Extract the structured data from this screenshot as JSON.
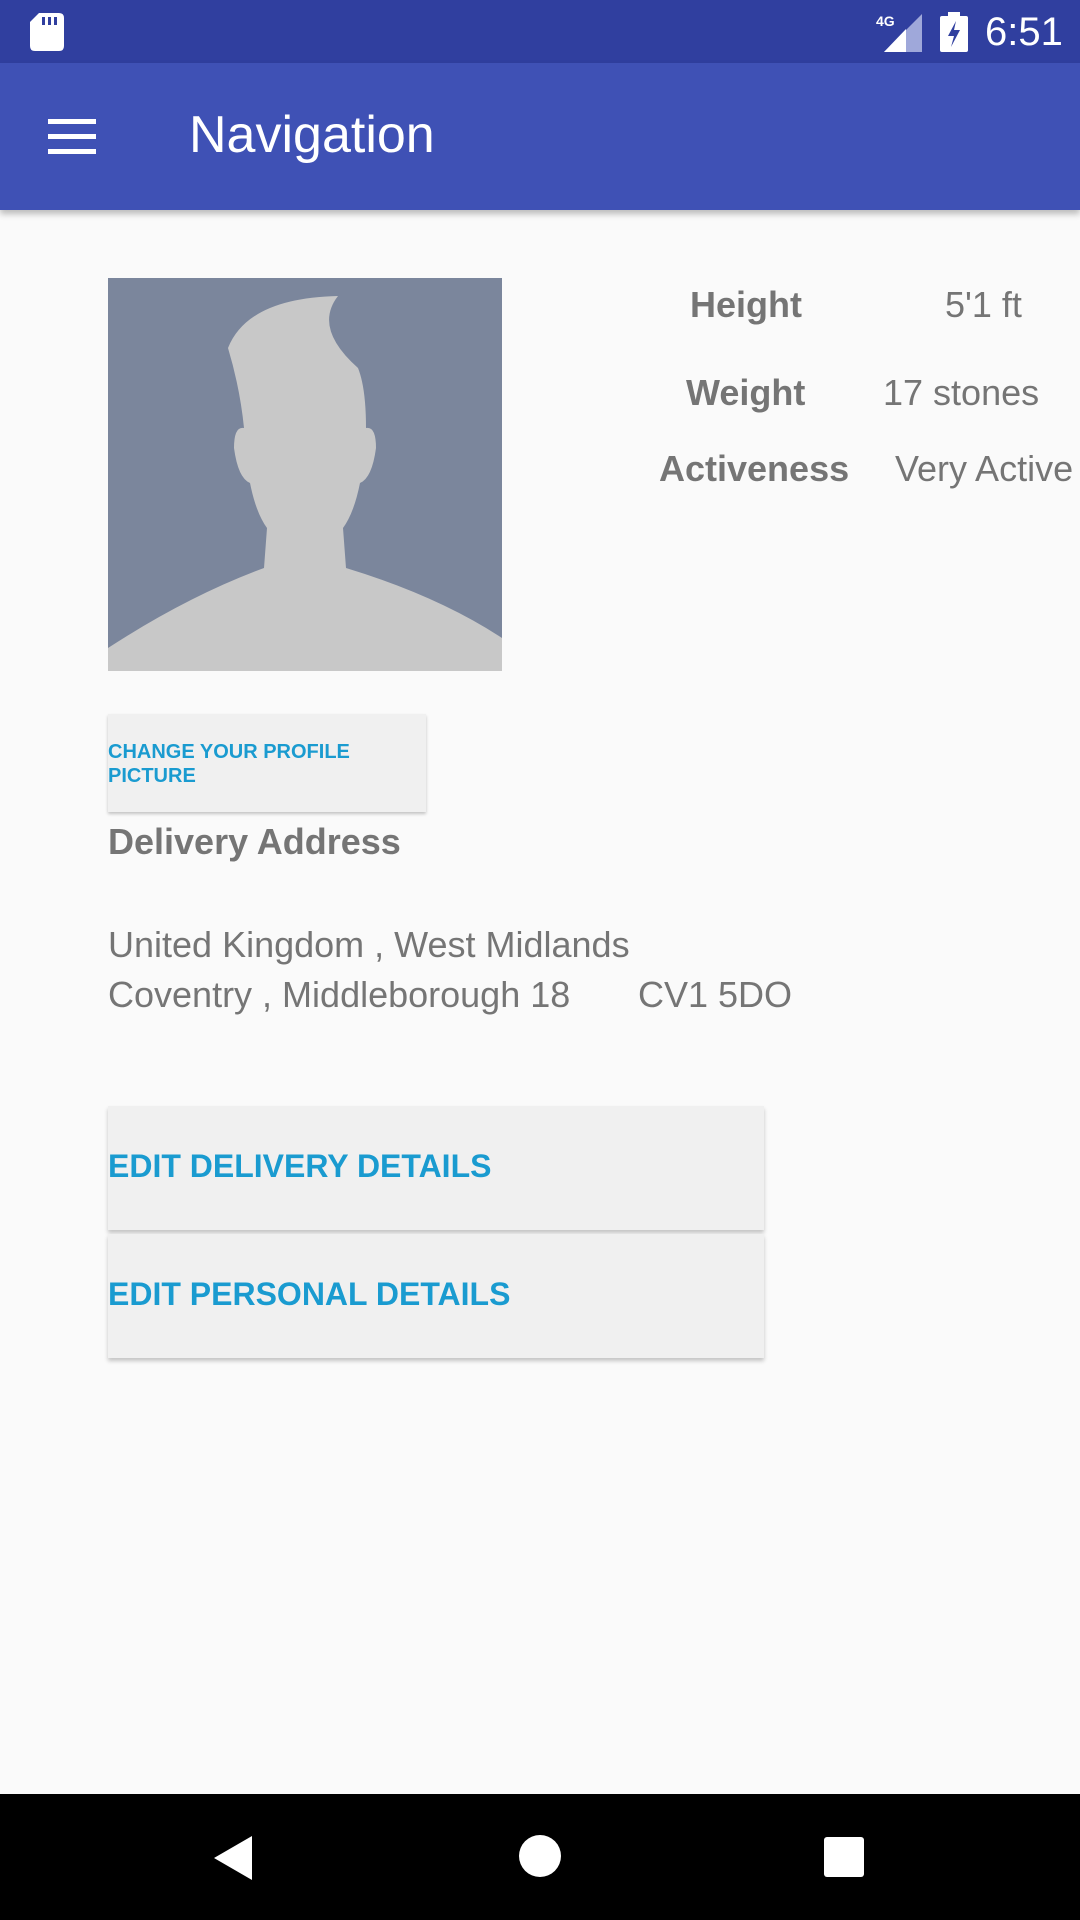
{
  "status_bar": {
    "time": "6:51",
    "network": "4G",
    "icons": [
      "sd-card-icon",
      "signal-icon",
      "battery-charging-icon"
    ]
  },
  "app_bar": {
    "title": "Navigation",
    "menu_icon": "menu-icon"
  },
  "profile": {
    "picture_icon": "avatar-placeholder",
    "change_picture_label": "CHANGE YOUR PROFILE PICTURE",
    "stats": [
      {
        "label": "Height",
        "value": "5'1 ft"
      },
      {
        "label": "Weight",
        "value": "17 stones"
      },
      {
        "label": "Activeness",
        "value": "Very Active"
      }
    ]
  },
  "delivery": {
    "heading": "Delivery Address",
    "line1": "United Kingdom , West Midlands",
    "line2": "Coventry , Middleborough 18",
    "postcode": "CV1 5DO"
  },
  "actions": {
    "edit_delivery": "EDIT DELIVERY DETAILS",
    "edit_personal": "EDIT PERSONAL DETAILS"
  },
  "colors": {
    "status_bar": "#303f9f",
    "app_bar": "#3f51b5",
    "accent": "#1a9bd0",
    "text_secondary": "#757575",
    "avatar_background": "#7b869c"
  },
  "nav_bar": {
    "icons": [
      "back-icon",
      "home-icon",
      "recents-icon"
    ]
  }
}
